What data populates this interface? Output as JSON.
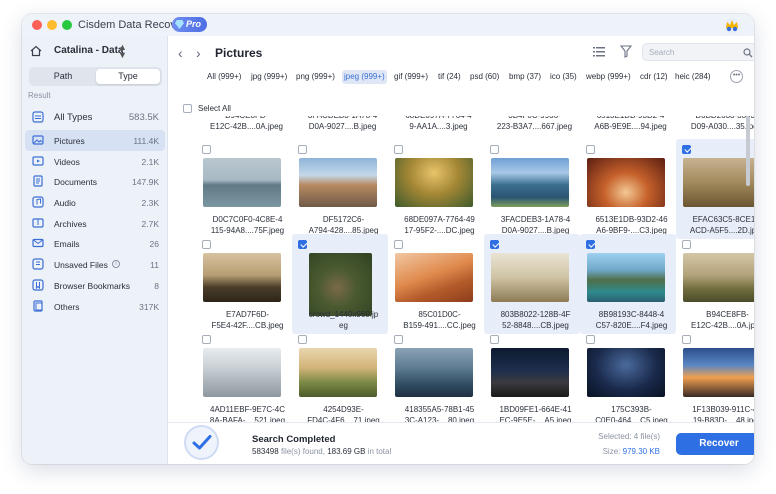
{
  "app": {
    "title": "Cisdem Data Recovery",
    "badge": "Pro",
    "traffic_lights": [
      "close",
      "minimize",
      "zoom"
    ]
  },
  "sidebar": {
    "drive": "Catalina - Data",
    "view_tabs": [
      "Path",
      "Type"
    ],
    "active_view": "Type",
    "result_label": "Result",
    "categories": [
      {
        "label": "All Types",
        "count": "583.5K",
        "icon": "stack-icon"
      },
      {
        "label": "Pictures",
        "count": "111.4K",
        "icon": "picture-icon",
        "active": true
      },
      {
        "label": "Videos",
        "count": "2.1K",
        "icon": "video-icon"
      },
      {
        "label": "Documents",
        "count": "147.9K",
        "icon": "document-icon"
      },
      {
        "label": "Audio",
        "count": "2.3K",
        "icon": "audio-icon"
      },
      {
        "label": "Archives",
        "count": "2.7K",
        "icon": "archive-icon"
      },
      {
        "label": "Emails",
        "count": "26",
        "icon": "email-icon"
      },
      {
        "label": "Unsaved Files",
        "count": "11",
        "icon": "unsaved-icon"
      },
      {
        "label": "Browser Bookmarks",
        "count": "8",
        "icon": "bookmark-icon"
      },
      {
        "label": "Others",
        "count": "317K",
        "icon": "others-icon"
      }
    ]
  },
  "main": {
    "title": "Pictures",
    "search_placeholder": "Search",
    "extensions": [
      {
        "label": "All (999+)"
      },
      {
        "label": "jpg (999+)"
      },
      {
        "label": "png (999+)"
      },
      {
        "label": "jpeg (999+)",
        "active": true
      },
      {
        "label": "gif (999+)"
      },
      {
        "label": "tif (24)"
      },
      {
        "label": "psd (60)"
      },
      {
        "label": "bmp (37)"
      },
      {
        "label": "ico (35)"
      },
      {
        "label": "webp (999+)"
      },
      {
        "label": "cdr (12)"
      },
      {
        "label": "heic (284)"
      }
    ],
    "select_all": "Select All",
    "partial_row": [
      [
        "B94CE8FB-",
        "E12C-42B....0A.jpeg"
      ],
      [
        "3FACDEB3-1A78-4",
        "D0A-9027....B.jpeg"
      ],
      [
        "68DE097A-7764-4",
        "9-AA1A....3.jpeg"
      ],
      [
        "3B4F0C-9936-",
        "223-B3A7....667.jpeg"
      ],
      [
        "6513E1DB-93D2-4",
        "A6B-9E9E....94.jpeg"
      ],
      [
        "D0BD2633-3303-",
        "D09-A030....35.jpeg"
      ]
    ],
    "files": [
      {
        "name": [
          "D0C7C0F0-4C8E-4",
          "115-94A8....75F.jpeg"
        ],
        "checked": false,
        "thumb": "lake"
      },
      {
        "name": [
          "DF5172C6-",
          "A794-428....85.jpeg"
        ],
        "checked": false,
        "thumb": "city"
      },
      {
        "name": [
          "68DE097A-7764-49",
          "17-95F2-....DC.jpeg"
        ],
        "checked": false,
        "thumb": "moss"
      },
      {
        "name": [
          "3FACDEB3-1A78-4",
          "D0A-9027....B.jpeg"
        ],
        "checked": false,
        "thumb": "fjord"
      },
      {
        "name": [
          "6513E1DB-93D2-46",
          "A6-9BF9-....C3.jpeg"
        ],
        "checked": false,
        "thumb": "canyon"
      },
      {
        "name": [
          "EFAC63C5-8CE1-4",
          "ACD-A5F5....2D.jpeg"
        ],
        "checked": true,
        "thumb": "grass"
      },
      {
        "name": [
          "E7AD7F6D-",
          "F5E4-42F....CB.jpeg"
        ],
        "checked": false,
        "thumb": "tree"
      },
      {
        "name": [
          "crowd_1440x960.jp",
          "eg"
        ],
        "checked": true,
        "thumb": "rabbit"
      },
      {
        "name": [
          "85C01D0C-",
          "B159-491....CC.jpeg"
        ],
        "checked": false,
        "thumb": "dunes"
      },
      {
        "name": [
          "803B8022-128B-4F",
          "52-8848....CB.jpeg"
        ],
        "checked": true,
        "thumb": "fence"
      },
      {
        "name": [
          "8B98193C-8448-4",
          "C57-820E....F4.jpeg"
        ],
        "checked": true,
        "thumb": "karst"
      },
      {
        "name": [
          "B94CE8FB-",
          "E12C-42B....0A.jpeg"
        ],
        "checked": false,
        "thumb": "meadow"
      },
      {
        "name": [
          "4AD11EBF-9E7C-4C",
          "8A-BAFA-....521.jpeg"
        ],
        "checked": false,
        "thumb": "frost"
      },
      {
        "name": [
          "4254D93E-",
          "FD4C-4F6....71.jpeg"
        ],
        "checked": false,
        "thumb": "balloon"
      },
      {
        "name": [
          "418355A5-78B1-45",
          "3C-A123-....80.jpeg"
        ],
        "checked": false,
        "thumb": "sea"
      },
      {
        "name": [
          "1BD09FE1-664E-41",
          "EC-9E5E-....A5.jpeg"
        ],
        "checked": false,
        "thumb": "night"
      },
      {
        "name": [
          "175C393B-",
          "C0E0-464....C5.jpeg"
        ],
        "checked": false,
        "thumb": "milkyway"
      },
      {
        "name": [
          "1F13B039-911C-4E",
          "19-B83D-....48.jpeg"
        ],
        "checked": false,
        "thumb": "sunset"
      }
    ]
  },
  "status": {
    "title": "Search Completed",
    "count": "583498",
    "count_suffix": "file(s) found,",
    "size": "183.69 GB",
    "size_suffix": "in total",
    "selected_label": "Selected:",
    "selected_value": "4 file(s)",
    "size_label": "Size:",
    "size_value": "979.30 KB",
    "recover_label": "Recover"
  },
  "colors": {
    "accent": "#2f6fe4",
    "sidebar_bg": "#edf1f8",
    "active_bg": "#d7e1f4"
  }
}
